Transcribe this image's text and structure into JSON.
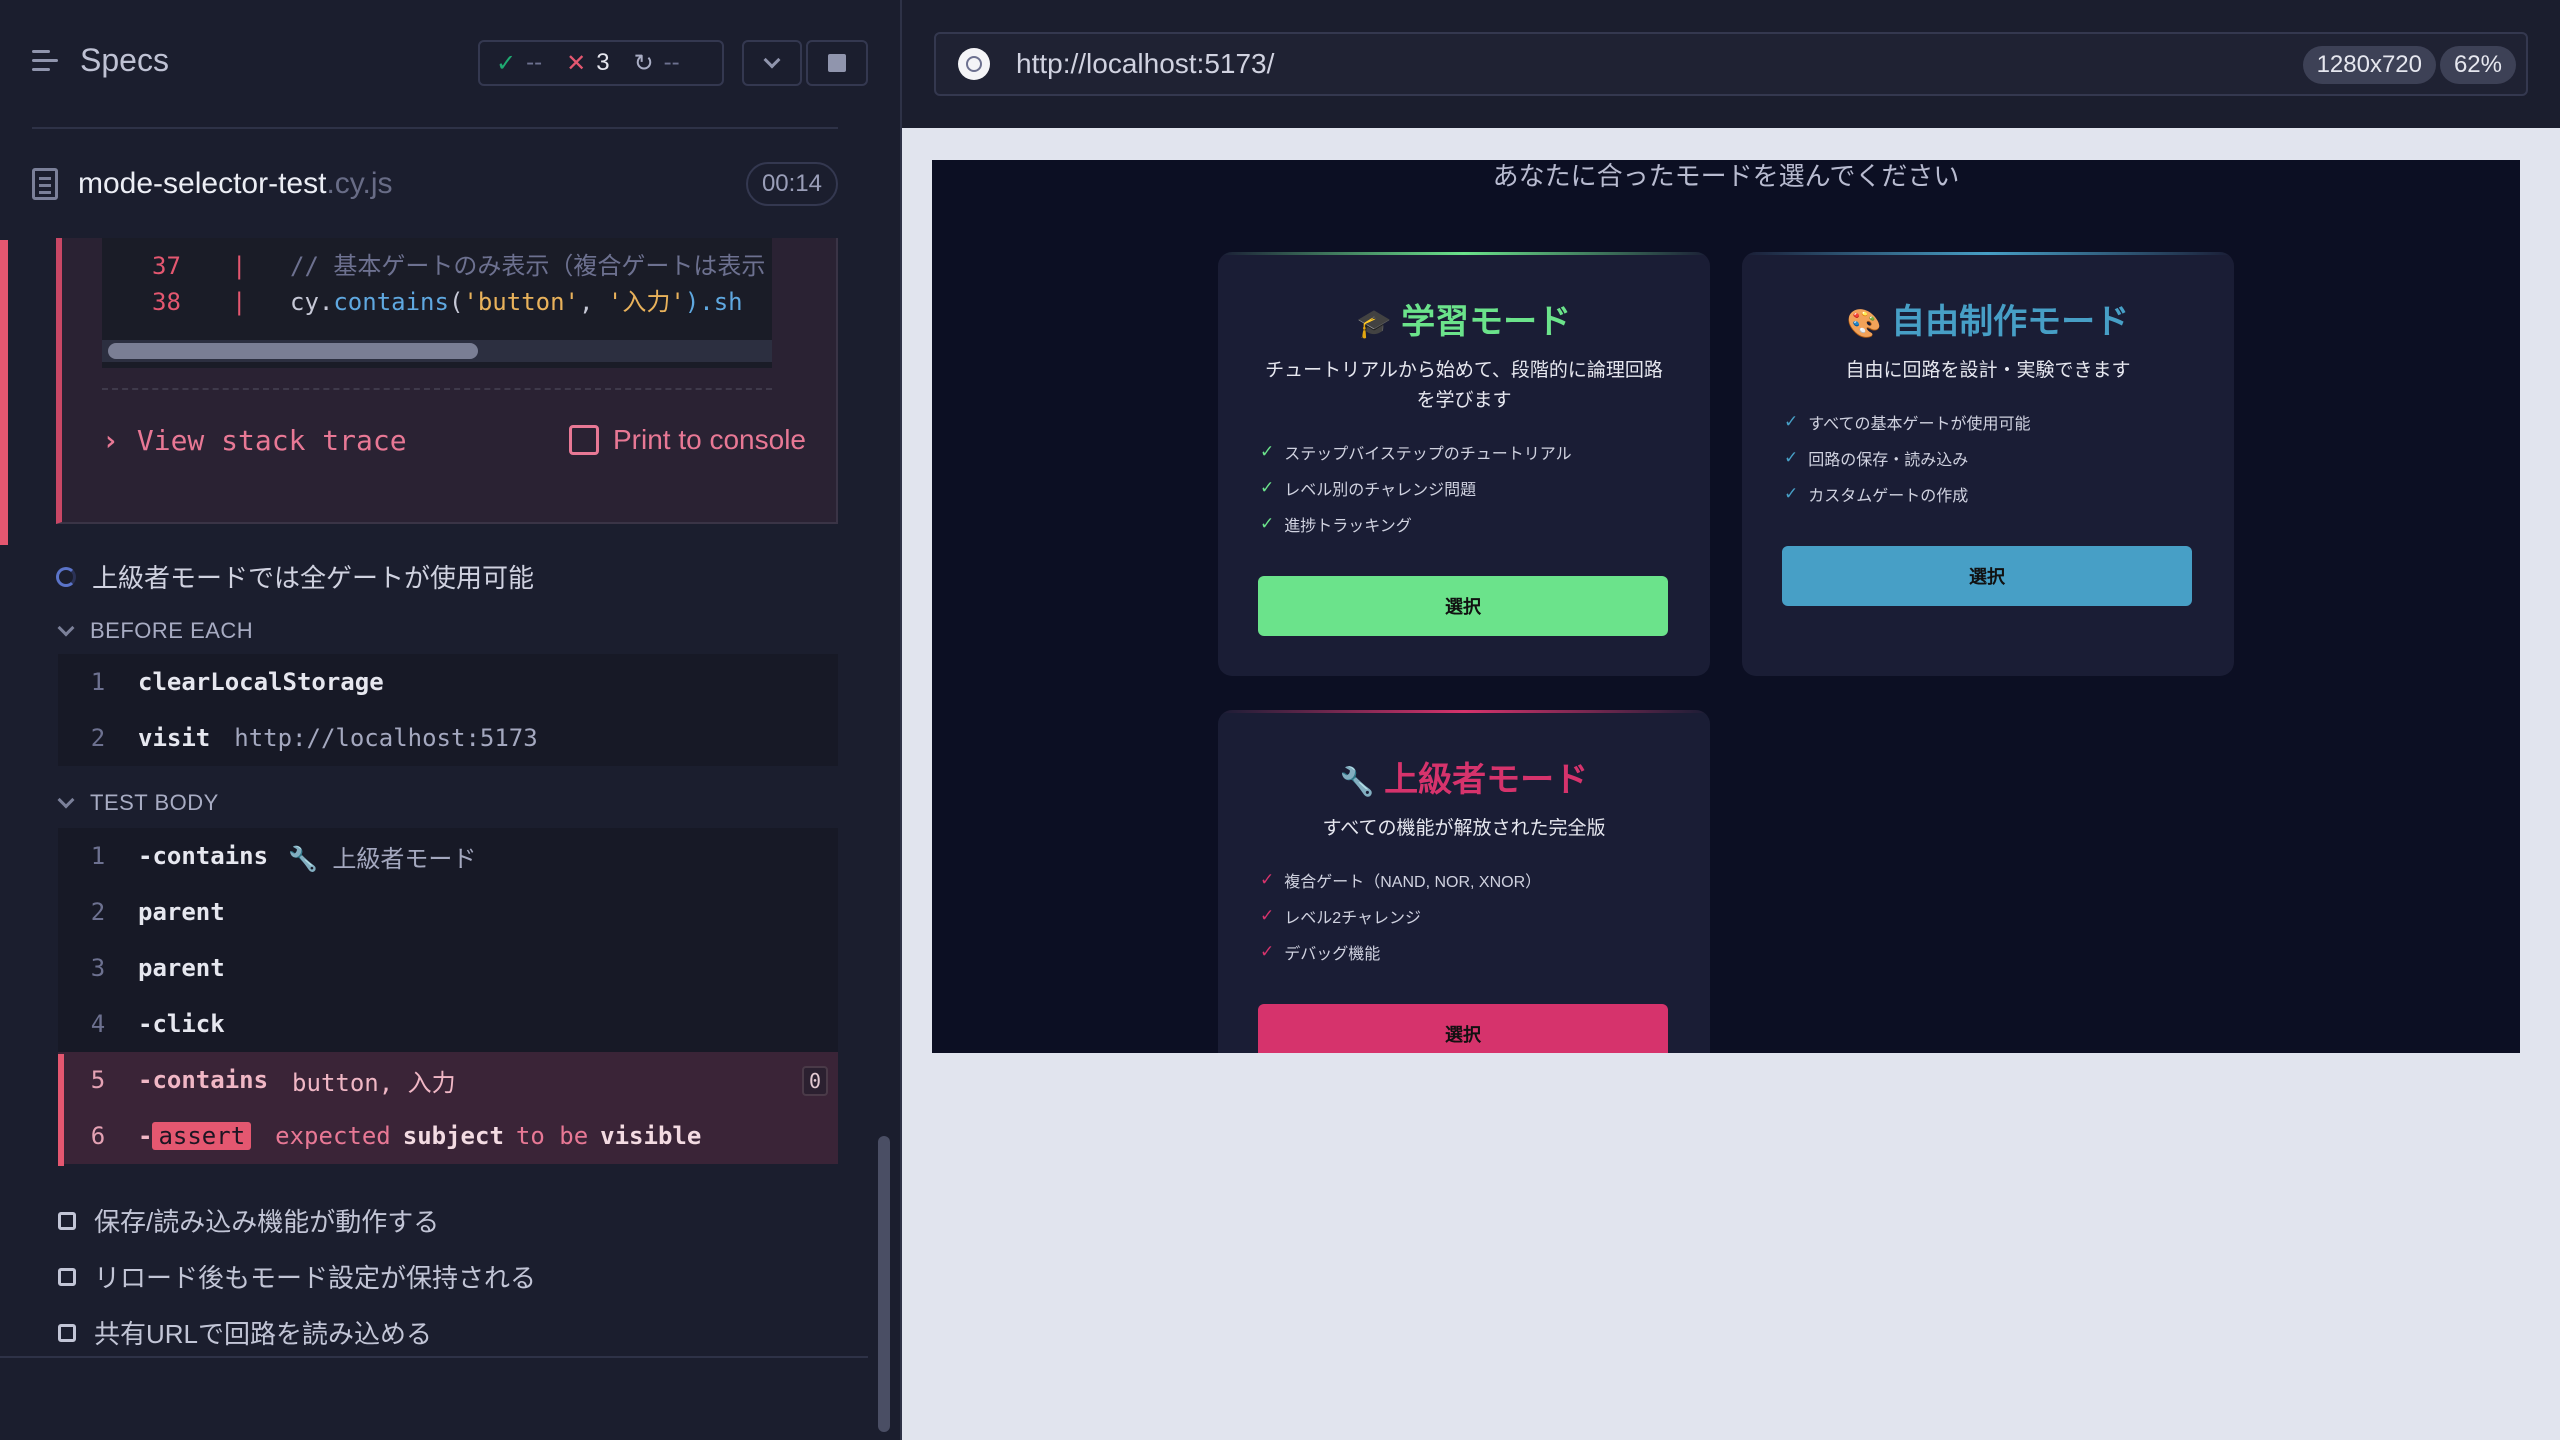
{
  "runner": {
    "specs_title": "Specs",
    "stats": {
      "passed": "--",
      "failed": "3",
      "pending": "--"
    },
    "spec_file": {
      "name": "mode-selector-test",
      "ext": ".cy.js",
      "duration": "00:14"
    },
    "error": {
      "code_lines": [
        {
          "num": "37",
          "comment": "// 基本ゲートのみ表示（複合ゲートは表示"
        },
        {
          "num": "38",
          "fn": "contains",
          "arg1": "'button'",
          "arg2": "'入力'",
          "tail": ").sh"
        }
      ],
      "view_stack_trace": "View stack trace",
      "print_to_console": "Print to console"
    },
    "current_test": "上級者モードでは全ゲートが使用可能",
    "before_each": {
      "title": "BEFORE EACH",
      "commands": [
        {
          "n": "1",
          "name": "clearLocalStorage",
          "arg": ""
        },
        {
          "n": "2",
          "name": "visit",
          "arg": "http://localhost:5173"
        }
      ]
    },
    "test_body": {
      "title": "TEST BODY",
      "commands": [
        {
          "n": "1",
          "name": "-contains",
          "arg": "🔧 上級者モード"
        },
        {
          "n": "2",
          "name": "parent",
          "arg": ""
        },
        {
          "n": "3",
          "name": "parent",
          "arg": ""
        },
        {
          "n": "4",
          "name": "-click",
          "arg": ""
        },
        {
          "n": "5",
          "name": "-contains",
          "arg": "button, 入力",
          "count": "0"
        },
        {
          "n": "6",
          "name_prefix": "-",
          "badge": "assert",
          "w1": "expected",
          "w2": "subject",
          "w3": "to be",
          "w4": "visible"
        }
      ]
    },
    "pending_tests": [
      "保存/読み込み機能が動作する",
      "リロード後もモード設定が保持される",
      "共有URLで回路を読み込める"
    ]
  },
  "preview": {
    "url": "http://localhost:5173/",
    "viewport": "1280x720",
    "zoom": "62%",
    "app": {
      "subtitle": "あなたに合ったモードを選んでください",
      "cards": [
        {
          "icon": "🎓",
          "title": "学習モード",
          "desc": "チュートリアルから始めて、段階的に論理回路を学びます",
          "features": [
            "ステップバイステップのチュートリアル",
            "レベル別のチャレンジ問題",
            "進捗トラッキング"
          ],
          "button": "選択",
          "color": "#6be38b"
        },
        {
          "icon": "🎨",
          "title": "自由制作モード",
          "desc": "自由に回路を設計・実験できます",
          "features": [
            "すべての基本ゲートが使用可能",
            "回路の保存・読み込み",
            "カスタムゲートの作成"
          ],
          "button": "選択",
          "color": "#479fc6"
        },
        {
          "icon": "🔧",
          "title": "上級者モード",
          "desc": "すべての機能が解放された完全版",
          "features": [
            "複合ゲート（NAND, NOR, XNOR）",
            "レベル2チャレンジ",
            "デバッグ機能"
          ],
          "button": "選択",
          "color": "#d6336c"
        }
      ]
    }
  },
  "colors": {
    "fail": "#e45770",
    "pass": "#1fa971",
    "learn": "#6be38b",
    "free": "#479fc6",
    "advanced": "#d6336c"
  }
}
